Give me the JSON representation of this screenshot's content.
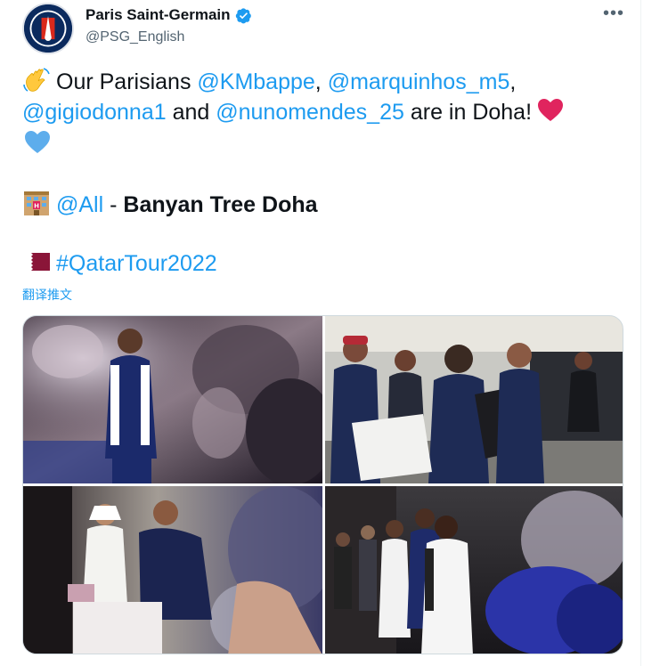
{
  "account": {
    "name": "Paris Saint-Germain",
    "handle": "@PSG_English",
    "verified": true,
    "avatar_icon": "psg-crest-icon"
  },
  "tweet": {
    "line1_pre": "Our Parisians ",
    "mention1": "@KMbappe",
    "sep1": ", ",
    "mention2": "@marquinhos_m5",
    "sep2": ",",
    "mention3": "@gigiodonna1",
    "and": " and ",
    "mention4": "@nunomendes_25",
    "line2_post": " are in Doha!",
    "mention5": "@All",
    "dash": " - ",
    "location": "Banyan Tree Doha",
    "hashtag": "#QatarTour2022",
    "emojis": [
      "waving-hand",
      "red-heart",
      "blue-heart",
      "hotel",
      "qatar-flag"
    ]
  },
  "translate_label": "翻译推文",
  "menu_icon_label": "•••",
  "colors": {
    "link": "#1d9bf0",
    "verified": "#1d9bf0",
    "text": "#0f1419",
    "muted": "#536471",
    "heart_red": "#e0245e",
    "heart_blue": "#5dadec",
    "qatar": "#8a1538"
  },
  "media": [
    {
      "alt": "player in blue jacket near silver sculpture"
    },
    {
      "alt": "players signing autographs for fans"
    },
    {
      "alt": "goalkeeper greeting guest at hotel"
    },
    {
      "alt": "players walking past blue sculpture"
    }
  ]
}
